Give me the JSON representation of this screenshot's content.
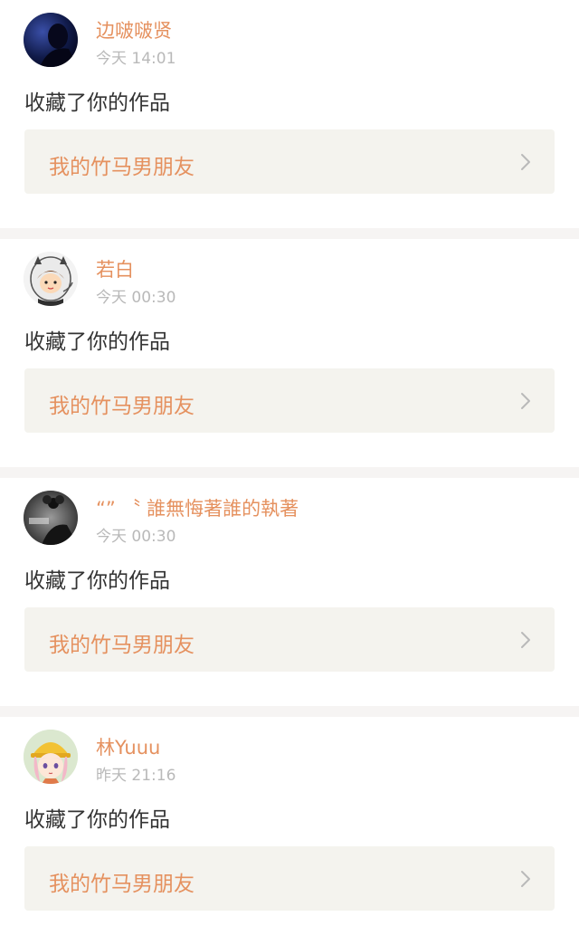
{
  "notifications": [
    {
      "username": "边啵啵贤",
      "time": "今天 14:01",
      "action": "收藏了你的作品",
      "work_title": "我的竹马男朋友",
      "avatar_icon": "dark-silhouette-avatar"
    },
    {
      "username": "若白",
      "time": "今天 00:30",
      "action": "收藏了你的作品",
      "work_title": "我的竹马男朋友",
      "avatar_icon": "cartoon-boy-avatar"
    },
    {
      "username": "“” 〝 誰無悔著誰的執著",
      "time": "今天 00:30",
      "action": "收藏了你的作品",
      "work_title": "我的竹马男朋友",
      "avatar_icon": "monochrome-photo-avatar"
    },
    {
      "username": "林Yuuu",
      "time": "昨天 21:16",
      "action": "收藏了你的作品",
      "work_title": "我的竹马男朋友",
      "avatar_icon": "anime-girl-hardhat-avatar"
    }
  ],
  "colors": {
    "accent": "#e5915f",
    "text": "#333333",
    "muted": "#b9b9b9",
    "box_bg": "#f4f3ee",
    "divider_bg": "#f6f4f3"
  }
}
